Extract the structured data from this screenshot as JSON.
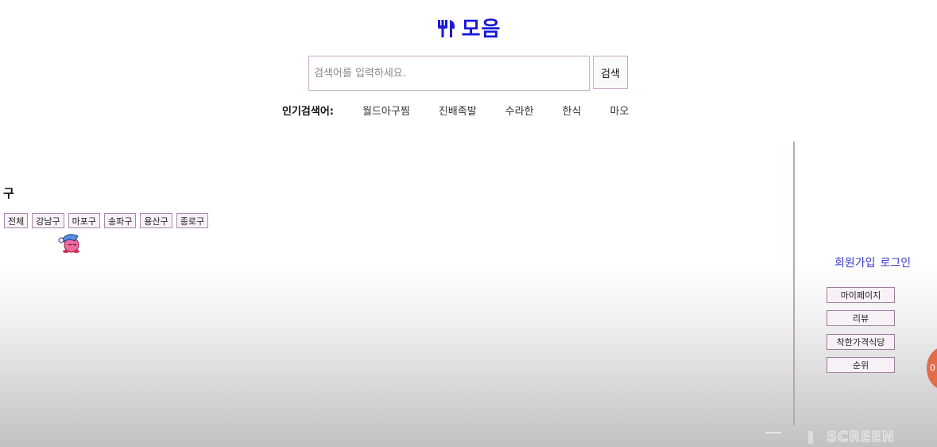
{
  "header": {
    "logo_text": "모음",
    "logo_icon": "fork-knife-icon",
    "accent_color": "#1a1ad6"
  },
  "search": {
    "placeholder": "검색어를 입력하세요.",
    "button_label": "검색"
  },
  "popular": {
    "label": "인기검색어:",
    "terms": [
      "월드아구찜",
      "진배족발",
      "수라한",
      "한식",
      "마오"
    ]
  },
  "district": {
    "title": "구",
    "buttons": [
      "전체",
      "강남구",
      "마포구",
      "송파구",
      "용산구",
      "종로구"
    ]
  },
  "sidebar": {
    "signup_label": "회원가입",
    "login_label": "로그인",
    "buttons": [
      "마이페이지",
      "리뷰",
      "착한가격식당",
      "순위"
    ],
    "orb_text": "0"
  },
  "watermark": {
    "text": "SCREEN"
  }
}
